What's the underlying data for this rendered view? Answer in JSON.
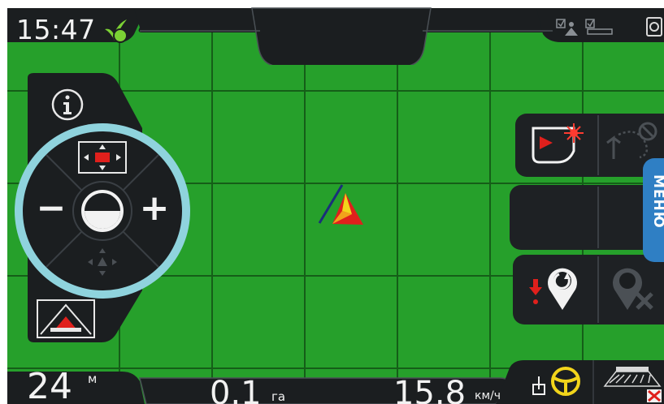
{
  "status": {
    "time": "15:47"
  },
  "left_panel": {
    "info_icon": "info-icon",
    "zoom_out_label": "−",
    "zoom_in_label": "+"
  },
  "right_panel": {
    "menu_label": "МЕНЮ"
  },
  "bottom_bar": {
    "width_value": "24",
    "width_unit": "м",
    "area_value": "0.1",
    "area_unit": "га",
    "speed_value": "15.8",
    "speed_unit": "км/ч"
  },
  "colors": {
    "field_green": "#26a02b",
    "grid_line": "#155e18",
    "panel_dark": "#1e2124",
    "accent_blue": "#2f7fc4",
    "ring_cyan": "#8fd3dd",
    "alert_red": "#e0201c",
    "steer_yellow": "#f2d51b"
  }
}
